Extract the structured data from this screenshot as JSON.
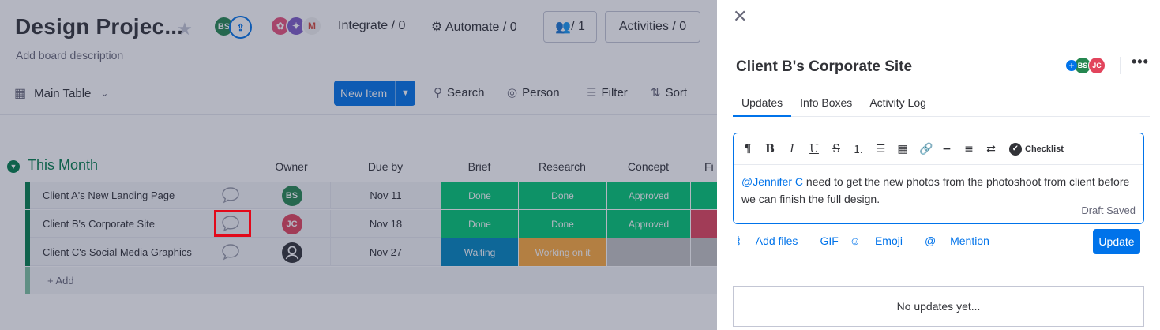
{
  "board": {
    "title": "Design Projec...",
    "description": "Add board description",
    "header_avatars": [
      {
        "initials": "BS",
        "color": "#258750"
      }
    ],
    "integrate_label": "Integrate / 0",
    "automate_label": "Automate / 0",
    "members_label": "/ 1",
    "activities_label": "Activities / 0",
    "view_label": "Main Table",
    "new_item_label": "New Item",
    "search_label": "Search",
    "person_label": "Person",
    "filter_label": "Filter",
    "sort_label": "Sort",
    "group_title": "This Month",
    "columns": {
      "owner": "Owner",
      "due": "Due by",
      "brief": "Brief",
      "research": "Research",
      "concept": "Concept",
      "final": "Fi"
    },
    "rows": [
      {
        "name": "Client A's New Landing Page",
        "owner": "BS",
        "due": "Nov 11",
        "brief": "Done",
        "research": "Done",
        "concept": "Approved"
      },
      {
        "name": "Client B's Corporate Site",
        "owner": "JC",
        "due": "Nov 18",
        "brief": "Done",
        "research": "Done",
        "concept": "Approved"
      },
      {
        "name": "Client C's Social Media Graphics",
        "owner": "",
        "due": "Nov 27",
        "brief": "Waiting",
        "research": "Working on it",
        "concept": ""
      }
    ],
    "add_label": "+ Add"
  },
  "panel": {
    "title": "Client B's Corporate Site",
    "avatars": [
      "BS",
      "JC"
    ],
    "tabs": [
      "Updates",
      "Info Boxes",
      "Activity Log"
    ],
    "active_tab": "Updates",
    "checklist_label": "Checklist",
    "mention": "@Jennifer C",
    "message": " need to get the new photos from the photoshoot from client before we can finish the full design.",
    "draft_status": "Draft Saved",
    "actions": [
      "Add files",
      "GIF",
      "Emoji",
      "Mention"
    ],
    "update_button": "Update",
    "empty_text": "No updates yet..."
  },
  "colors": {
    "accent": "#0073ea",
    "done": "#00c875",
    "waiting": "#0086c0",
    "working": "#fdab3d",
    "group": "#037f4c"
  }
}
